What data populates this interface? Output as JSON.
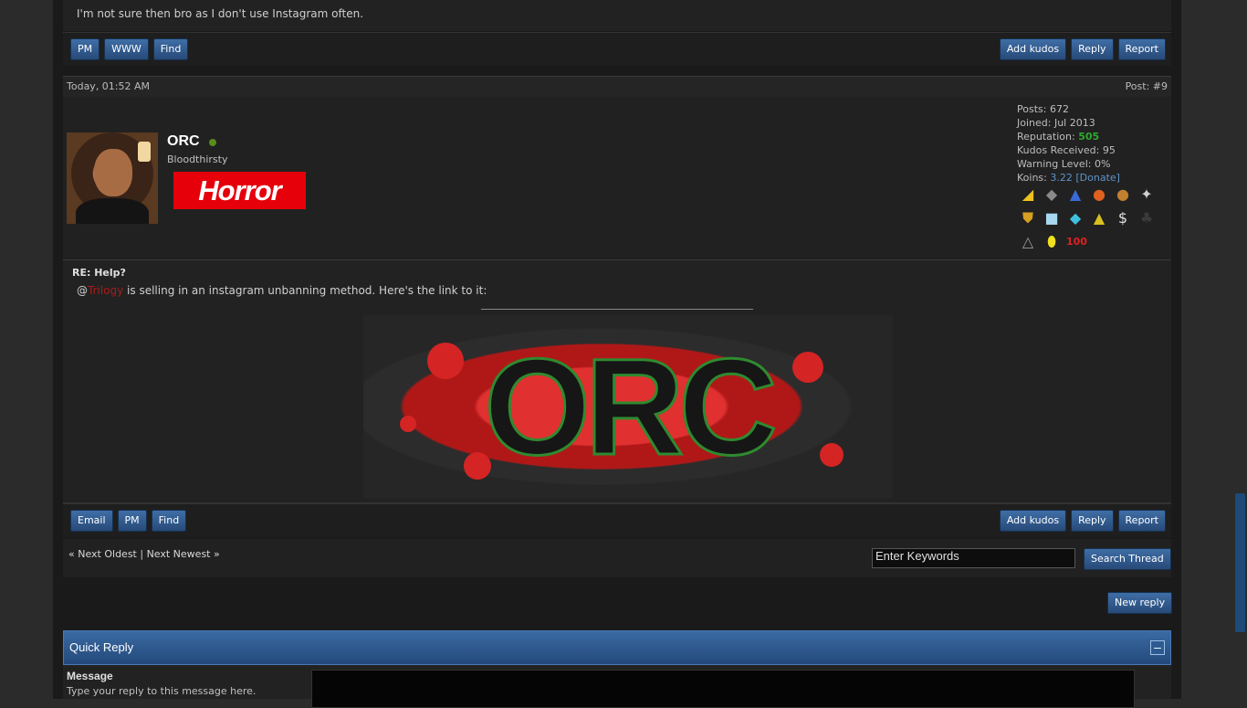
{
  "prev_post": {
    "message": "I'm not sure then bro as I don't use Instagram often.",
    "buttons_left": [
      "PM",
      "WWW",
      "Find"
    ],
    "buttons_right": [
      "Add kudos",
      "Reply",
      "Report"
    ]
  },
  "post": {
    "date": "Today, 01:52 AM",
    "number": "Post: #9",
    "author": {
      "name": "ORC",
      "title": "Bloodthirsty",
      "userbar_text": "Horror",
      "posts_label": "Posts:",
      "posts": "672",
      "joined_label": "Joined:",
      "joined": "Jul 2013",
      "reputation_label": "Reputation:",
      "reputation": "505",
      "kudos_label": "Kudos Received:",
      "kudos": "95",
      "warning_label": "Warning Level:",
      "warning": "0%",
      "koins_label": "Koins:",
      "koins": "3.22",
      "donate": "[Donate]"
    },
    "awards": [
      "cheese-icon",
      "diamond-gem-icon",
      "rocket-icon",
      "bomb-icon",
      "sunglasses-icon",
      "shuriken-icon",
      "shield-crest-icon",
      "ice-cube-icon",
      "diamond-icon",
      "triforce-icon",
      "money-bag-icon",
      "bunny-icon",
      "illuminati-icon",
      "golden-egg-icon",
      "hundred-icon"
    ],
    "subject": "RE: Help?",
    "message_prefix": "@",
    "mention": "Trilogy",
    "message_suffix": " is selling in an instagram unbanning method. Here's the link to it:",
    "signature_text": "ORC",
    "buttons_left": [
      "Email",
      "PM",
      "Find"
    ],
    "buttons_right": [
      "Add kudos",
      "Reply",
      "Report"
    ]
  },
  "thread_nav": {
    "prev": "« Next Oldest",
    "sep": " | ",
    "next": "Next Newest »",
    "search_placeholder": "Enter Keywords",
    "search_button": "Search Thread"
  },
  "new_reply": "New reply",
  "quick_reply": {
    "title": "Quick Reply",
    "collapse": "–",
    "message_label": "Message",
    "message_hint": "Type your reply to this message here."
  }
}
